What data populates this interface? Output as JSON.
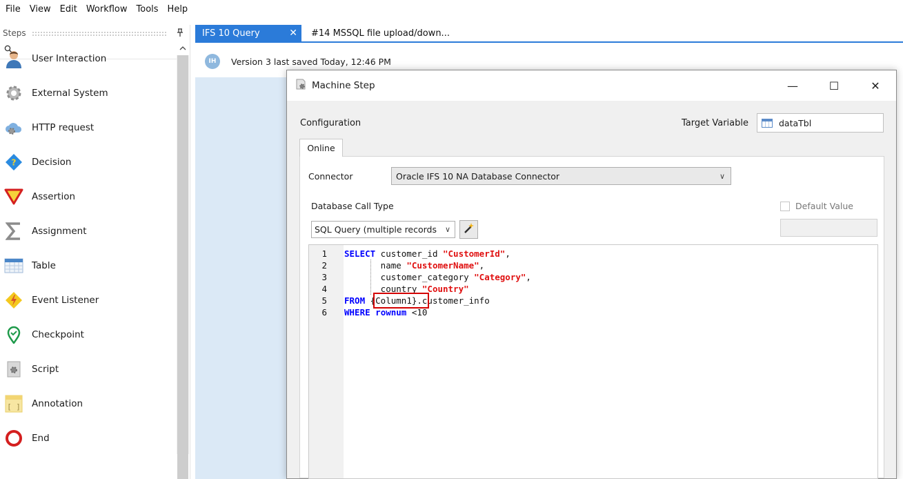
{
  "menu": [
    "File",
    "View",
    "Edit",
    "Workflow",
    "Tools",
    "Help"
  ],
  "steps_panel": {
    "title": "Steps",
    "pin_glyph": "Ԅ",
    "items": [
      {
        "label": "User Interaction",
        "icon": "user-icon"
      },
      {
        "label": "External System",
        "icon": "gear-icon"
      },
      {
        "label": "HTTP request",
        "icon": "cloud-gear-icon"
      },
      {
        "label": "Decision",
        "icon": "decision-diamond-icon"
      },
      {
        "label": "Assertion",
        "icon": "assertion-triangle-icon"
      },
      {
        "label": "Assignment",
        "icon": "sigma-icon"
      },
      {
        "label": "Table",
        "icon": "table-icon"
      },
      {
        "label": "Event Listener",
        "icon": "lightning-icon"
      },
      {
        "label": "Checkpoint",
        "icon": "checkpoint-pin-icon"
      },
      {
        "label": "Script",
        "icon": "script-icon"
      },
      {
        "label": "Annotation",
        "icon": "annotation-icon"
      },
      {
        "label": "End",
        "icon": "end-circle-icon"
      }
    ]
  },
  "tabs": [
    {
      "label": "IFS 10 Query",
      "active": true
    },
    {
      "label": "#14 MSSQL file upload/down...",
      "active": false
    }
  ],
  "version": {
    "avatar": "IH",
    "text": "Version 3 last saved Today, 12:46 PM"
  },
  "dialog": {
    "title": "Machine Step",
    "controls": {
      "minimize": "—",
      "maximize": "☐",
      "close": "✕"
    },
    "configuration_label": "Configuration",
    "target_variable_label": "Target Variable",
    "target_variable_value": "dataTbl",
    "tab_label": "Online",
    "connector_label": "Connector",
    "connector_value": "Oracle IFS 10 NA Database Connector",
    "db_call_type_label": "Database Call Type",
    "db_call_type_value": "SQL Query (multiple records",
    "default_value_label": "Default Value",
    "default_value_checked": false,
    "chevron": "∨"
  },
  "code": {
    "line_numbers": [
      "1",
      "2",
      "3",
      "4",
      "5",
      "6"
    ],
    "l1": {
      "kw": "SELECT",
      "a": " customer_id ",
      "s": "\"CustomerId\"",
      "b": ","
    },
    "l2": {
      "a": "       name ",
      "s": "\"CustomerName\"",
      "b": ","
    },
    "l3": {
      "a": "       customer_category ",
      "s": "\"Category\"",
      "b": ","
    },
    "l4": {
      "a": "       country ",
      "s": "\"Country\""
    },
    "l5": {
      "kw": "FROM",
      "a": " {Column1}",
      "b": ".customer_info"
    },
    "l6": {
      "kw": "WHERE",
      "kw2": " rownum",
      "a": " <10"
    }
  },
  "colors": {
    "accent": "#2b7bd9",
    "keyword": "#0000ff",
    "string": "#e01010",
    "highlight": "#d40000",
    "canvas": "#dbe9f6"
  }
}
